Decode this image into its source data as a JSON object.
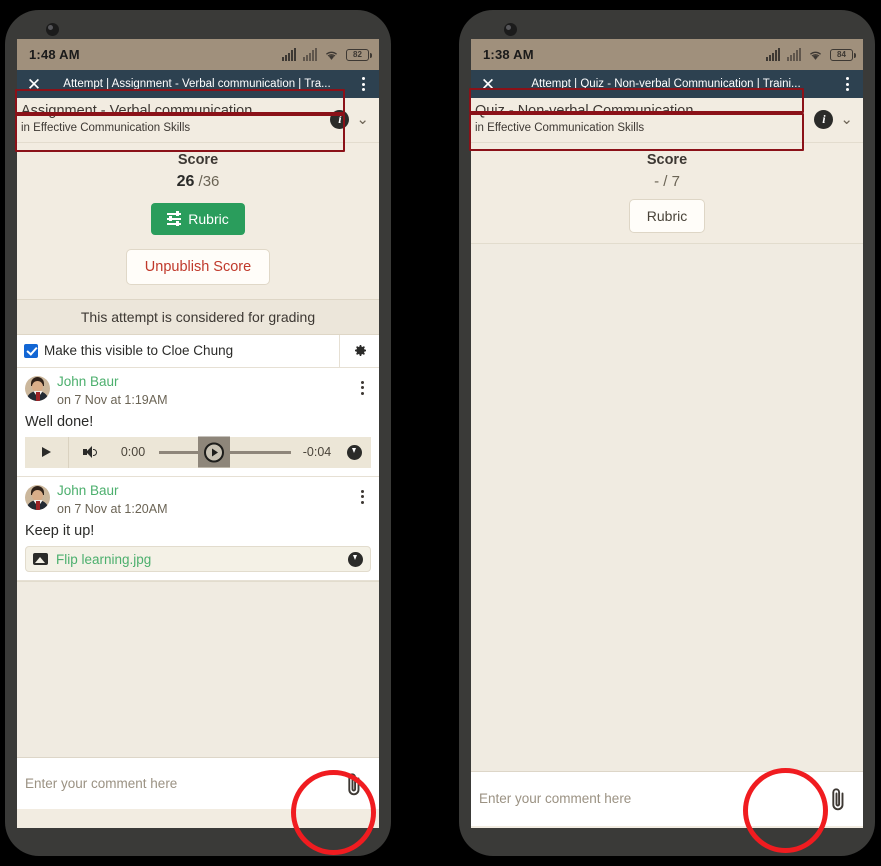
{
  "page": {
    "background_color": "#000000",
    "phone_frame_color": "#3a3a38",
    "screen_background": "#f2ece1",
    "accent_green": "#2a9d5c",
    "link_green": "#4caf6d",
    "appbar_color": "#2d4150",
    "statusbar_color": "#a0907c",
    "danger_red": "#c0392b",
    "annotation_box_color": "#8b1118",
    "annotation_circle_color": "#f01c20"
  },
  "left_phone": {
    "statusbar": {
      "time": "1:48 AM",
      "battery_level": "82",
      "signal_icon": "signal-bars-icon",
      "wifi_icon": "wifi-icon",
      "battery_icon": "battery-icon"
    },
    "appbar": {
      "close_icon": "close-icon",
      "title": "Attempt | Assignment - Verbal communication | Tra...",
      "menu_icon": "kebab-menu-icon"
    },
    "context": {
      "title": "Assignment - Verbal communication",
      "subtitle": "in Effective Communication Skills",
      "info_icon": "info-icon",
      "expand_icon": "double-chevron-down-icon"
    },
    "score": {
      "label": "Score",
      "value": "26",
      "total": "/36"
    },
    "rubric_button": {
      "label": "Rubric",
      "icon": "tune-sliders-icon",
      "style": "green-filled"
    },
    "unpublish_button": {
      "label": "Unpublish Score"
    },
    "grading_note": "This attempt is considered for grading",
    "visibility": {
      "checked": true,
      "label": "Make this visible to Cloe Chung",
      "settings_icon": "gear-icon"
    },
    "comments": [
      {
        "author": "John Baur",
        "time": "on 7 Nov at 1:19AM",
        "text": "Well done!",
        "avatar_icon": "avatar",
        "menu_icon": "kebab-menu-icon",
        "audio": {
          "play_icon": "play-icon",
          "volume_icon": "volume-icon",
          "current_time": "0:00",
          "remaining_time": "-0:04",
          "download_icon": "download-icon",
          "progress_percent": 42
        }
      },
      {
        "author": "John Baur",
        "time": "on 7 Nov at 1:20AM",
        "text": "Keep it up!",
        "avatar_icon": "avatar",
        "menu_icon": "kebab-menu-icon",
        "attachment": {
          "name": "Flip learning.jpg",
          "file_icon": "image-file-icon",
          "download_icon": "download-icon"
        }
      }
    ],
    "comment_input": {
      "placeholder": "Enter your comment here",
      "value": "",
      "attach_icon": "paperclip-icon"
    }
  },
  "right_phone": {
    "statusbar": {
      "time": "1:38 AM",
      "battery_level": "84",
      "signal_icon": "signal-bars-icon",
      "wifi_icon": "wifi-icon",
      "battery_icon": "battery-icon"
    },
    "appbar": {
      "close_icon": "close-icon",
      "title": "Attempt | Quiz - Non-verbal Communication | Traini...",
      "menu_icon": "kebab-menu-icon"
    },
    "context": {
      "title": "Quiz - Non-verbal Communication",
      "subtitle": "in Effective Communication Skills",
      "info_icon": "info-icon",
      "expand_icon": "double-chevron-down-icon"
    },
    "score": {
      "label": "Score",
      "value": "-",
      "total": "/ 7"
    },
    "rubric_button": {
      "label": "Rubric",
      "style": "white-outlined"
    },
    "comment_input": {
      "placeholder": "Enter your comment here",
      "value": "",
      "attach_icon": "paperclip-icon"
    }
  }
}
